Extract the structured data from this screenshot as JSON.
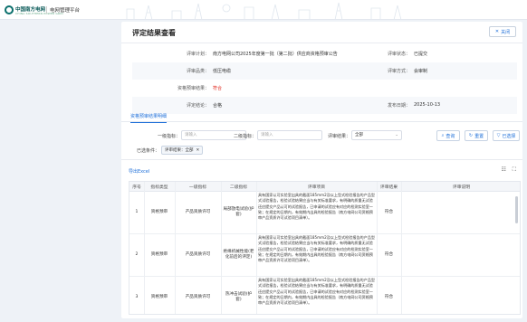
{
  "header": {
    "company_cn": "中国南方电网",
    "company_en": "CHINA SOUTHERN POWER GRID",
    "platform": "电网管理平台"
  },
  "page": {
    "title": "评定结果查看",
    "close_label": "关闭"
  },
  "info": {
    "plan_label": "评审计划：",
    "plan_value": "南方电网公司2025年度第一批（第二批）供应商资格预审公告",
    "status_label": "评审状态：",
    "status_value": "已提交",
    "category_label": "评审品类：",
    "category_value": "低压电缆",
    "method_label": "评审方式：",
    "method_value": "会审制",
    "qualified_label": "资格预审结果：",
    "qualified_value": "符合",
    "result_label": "评定结论：",
    "result_value": "合格",
    "date_label": "发布日期：",
    "date_value": "2025-10-13"
  },
  "tabs": {
    "active": "资格预审结果明细"
  },
  "filters": {
    "level1_label": "一级指标：",
    "level1_placeholder": "请输入",
    "level2_label": "二级指标：",
    "level2_placeholder": "请输入",
    "result_label": "评审结果：",
    "result_value": "全部",
    "query_label": "查询",
    "reset_label": "重置",
    "filter_label": "已选择",
    "selected_label": "已选条件：",
    "chip_text": "评审结果：全部"
  },
  "toolbar": {
    "export_label": "导出Excel"
  },
  "table": {
    "headers": [
      "序号",
      "指标类型",
      "一级指标",
      "二级指标",
      "评审项目",
      "评审结果",
      "评审说明"
    ],
    "rows": [
      {
        "no": "1",
        "type": "资格预审",
        "level1": "产品资质许可",
        "level2": "局部放电试验(护套)",
        "req": "具有国家认可实验室出具的截面185mm2及以上型式检验报告的产品型式试验报告，检验试验结果应当与有关标准要求，有明确的质量无试验还应提交产品认可的试验报告，已申请的试验应有对应的检测实验室一致；在规定的日期内，有效期内出具的检验报告（南方电网公司资格预审产品资质许可试验项目清单）。",
        "result": "符合",
        "desc": ""
      },
      {
        "no": "2",
        "type": "资格预审",
        "level1": "产品资质许可",
        "level2": "绝缘机械性能(老化前后的评定)",
        "req": "具有国家认可实验室出具的截面185mm2及以上型式检验报告的产品型式试验报告，检验试验结果应当与有关标准要求，有明确的质量无试验还应提交产品认可的试验报告，已申请的试验应有对应的检测实验室一致；在规定的日期内，有效期内出具的检验报告（南方电网公司资格预审产品资质许可试验项目清单）。",
        "result": "符合",
        "desc": ""
      },
      {
        "no": "3",
        "type": "资格预审",
        "level1": "产品资质许可",
        "level2": "热冲击试验(护套)",
        "req": "具有国家认可实验室出具的截面185mm2及以上型式检验报告的产品型式试验报告，检验试验结果应当与有关标准要求，有明确的质量无试验还应提交产品认可的试验报告，已申请的试验应有对应的检测实验室一致；在规定的日期内，有效期内出具的检验报告（南方电网公司资格预审产品资质许可试验项目清单）。",
        "result": "符合",
        "desc": ""
      }
    ]
  },
  "colors": {
    "accent": "#1e6fd9",
    "danger": "#e0261b",
    "brand": "#0a6f6c"
  }
}
